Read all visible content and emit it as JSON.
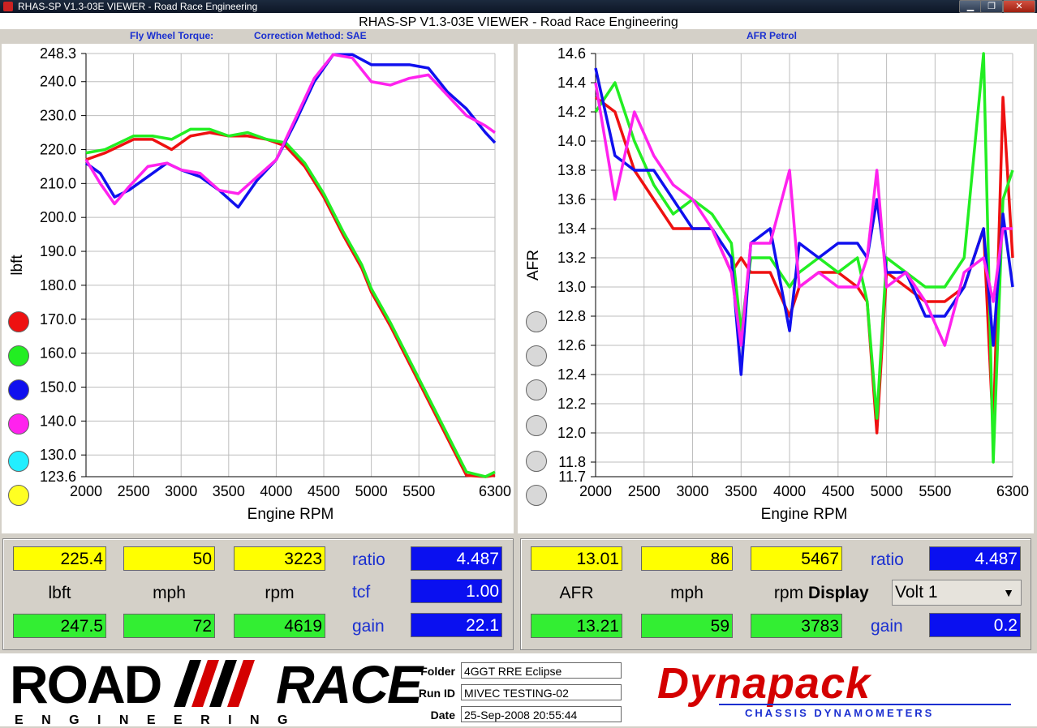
{
  "window": {
    "title": "RHAS-SP V1.3-03E VIEWER - Road Race Engineering"
  },
  "app": {
    "title": "RHAS-SP V1.3-03E VIEWER - Road Race Engineering"
  },
  "left_chart": {
    "header1": "Fly Wheel Torque:",
    "header2": "Correction Method: SAE",
    "ylabel": "lbft",
    "xlabel": "Engine RPM",
    "ymin_label": "123.6",
    "ymax_label": "248.3",
    "yticks": [
      "240.0",
      "230.0",
      "220.0",
      "210.0",
      "200.0",
      "190.0",
      "180.0",
      "170.0",
      "160.0",
      "150.0",
      "140.0",
      "130.0"
    ],
    "xticks": [
      "2000",
      "2500",
      "3000",
      "3500",
      "4000",
      "4500",
      "5000",
      "5500",
      "6300"
    ]
  },
  "right_chart": {
    "header": "AFR Petrol",
    "ylabel": "AFR",
    "xlabel": "Engine RPM",
    "yticks": [
      "14.6",
      "14.4",
      "14.2",
      "14.0",
      "13.8",
      "13.6",
      "13.4",
      "13.2",
      "13.0",
      "12.8",
      "12.6",
      "12.4",
      "12.2",
      "12.0",
      "11.8",
      "11.7"
    ],
    "xticks": [
      "2000",
      "2500",
      "3000",
      "3500",
      "4000",
      "4500",
      "5000",
      "5500",
      "6300"
    ]
  },
  "colors": {
    "red": "#ee1111",
    "green": "#22ee22",
    "blue": "#1010ee",
    "magenta": "#ff22ee",
    "cyan": "#22eeff",
    "yellow": "#ffff22"
  },
  "chart_data": [
    {
      "type": "line",
      "xlabel": "Engine RPM",
      "ylabel": "lbft",
      "xlim": [
        2000,
        6300
      ],
      "ylim": [
        123.6,
        248.3
      ],
      "series": [
        {
          "color": "red",
          "x": [
            2000,
            2200,
            2500,
            2700,
            2900,
            3100,
            3300,
            3500,
            3700,
            3900,
            4100,
            4300,
            4500,
            4700,
            4900,
            5000,
            5200,
            5400,
            5600,
            5800,
            6000,
            6200,
            6300
          ],
          "y": [
            217,
            219,
            223,
            223,
            220,
            224,
            225,
            224,
            224,
            223,
            221,
            215,
            206,
            195,
            185,
            178,
            168,
            157,
            146,
            135,
            124,
            108,
            124
          ]
        },
        {
          "color": "green",
          "x": [
            2000,
            2200,
            2500,
            2700,
            2900,
            3100,
            3300,
            3500,
            3700,
            3900,
            4100,
            4300,
            4500,
            4700,
            4900,
            5000,
            5200,
            5400,
            5600,
            5800,
            6000,
            6200,
            6300
          ],
          "y": [
            219,
            220,
            224,
            224,
            223,
            226,
            226,
            224,
            225,
            223,
            222,
            216,
            207,
            196,
            186,
            179,
            169,
            158,
            147,
            136,
            125,
            109,
            125
          ]
        },
        {
          "color": "blue",
          "x": [
            2000,
            2150,
            2300,
            2450,
            2650,
            2850,
            3000,
            3200,
            3400,
            3600,
            3800,
            4000,
            4200,
            4400,
            4600,
            4800,
            5000,
            5200,
            5400,
            5600,
            5800,
            6000,
            6200,
            6300
          ],
          "y": [
            216,
            213,
            206,
            208,
            212,
            216,
            214,
            212,
            208,
            203,
            211,
            217,
            228,
            240,
            248,
            248,
            245,
            245,
            245,
            244,
            237,
            232,
            225,
            222
          ]
        },
        {
          "color": "magenta",
          "x": [
            2000,
            2150,
            2300,
            2450,
            2650,
            2850,
            3000,
            3200,
            3400,
            3600,
            3800,
            4000,
            4200,
            4400,
            4600,
            4800,
            5000,
            5200,
            5400,
            5600,
            5800,
            6000,
            6200,
            6300
          ],
          "y": [
            217,
            210,
            204,
            209,
            215,
            216,
            214,
            213,
            208,
            207,
            212,
            217,
            229,
            241,
            248,
            247,
            240,
            239,
            241,
            242,
            236,
            230,
            227,
            225
          ]
        }
      ]
    },
    {
      "type": "line",
      "xlabel": "Engine RPM",
      "ylabel": "AFR",
      "xlim": [
        2000,
        6300
      ],
      "ylim": [
        11.7,
        14.6
      ],
      "series": [
        {
          "color": "red",
          "x": [
            2000,
            2200,
            2400,
            2600,
            2800,
            3000,
            3200,
            3400,
            3500,
            3600,
            3800,
            4000,
            4100,
            4300,
            4500,
            4700,
            4800,
            4900,
            5000,
            5200,
            5400,
            5600,
            5800,
            6000,
            6100,
            6200,
            6300
          ],
          "y": [
            14.3,
            14.2,
            13.8,
            13.6,
            13.4,
            13.4,
            13.4,
            13.1,
            13.2,
            13.1,
            13.1,
            12.8,
            13.0,
            13.1,
            13.1,
            13.0,
            12.9,
            12.0,
            13.1,
            13.0,
            12.9,
            12.9,
            13.0,
            13.4,
            12.0,
            14.3,
            13.2
          ]
        },
        {
          "color": "green",
          "x": [
            2000,
            2200,
            2400,
            2600,
            2800,
            3000,
            3200,
            3400,
            3500,
            3600,
            3800,
            4000,
            4100,
            4300,
            4500,
            4700,
            4800,
            4900,
            5000,
            5200,
            5400,
            5600,
            5800,
            6000,
            6100,
            6200,
            6300
          ],
          "y": [
            14.2,
            14.4,
            14.0,
            13.7,
            13.5,
            13.6,
            13.5,
            13.3,
            12.7,
            13.2,
            13.2,
            13.0,
            13.1,
            13.2,
            13.1,
            13.2,
            12.9,
            12.1,
            13.2,
            13.1,
            13.0,
            13.0,
            13.2,
            14.6,
            11.8,
            13.6,
            13.8
          ]
        },
        {
          "color": "blue",
          "x": [
            2000,
            2200,
            2400,
            2600,
            2800,
            3000,
            3200,
            3400,
            3500,
            3600,
            3800,
            4000,
            4100,
            4300,
            4500,
            4700,
            4800,
            4900,
            5000,
            5200,
            5400,
            5600,
            5800,
            6000,
            6100,
            6200,
            6300
          ],
          "y": [
            14.5,
            13.9,
            13.8,
            13.8,
            13.6,
            13.4,
            13.4,
            13.2,
            12.4,
            13.3,
            13.4,
            12.7,
            13.3,
            13.2,
            13.3,
            13.3,
            13.2,
            13.6,
            13.1,
            13.1,
            12.8,
            12.8,
            13.0,
            13.4,
            12.6,
            13.5,
            13.0
          ]
        },
        {
          "color": "magenta",
          "x": [
            2000,
            2200,
            2400,
            2600,
            2800,
            3000,
            3200,
            3400,
            3500,
            3600,
            3800,
            4000,
            4100,
            4300,
            4500,
            4700,
            4800,
            4900,
            5000,
            5200,
            5400,
            5600,
            5800,
            6000,
            6100,
            6200,
            6300
          ],
          "y": [
            14.4,
            13.6,
            14.2,
            13.9,
            13.7,
            13.6,
            13.4,
            13.1,
            12.6,
            13.3,
            13.3,
            13.8,
            13.0,
            13.1,
            13.0,
            13.0,
            13.2,
            13.8,
            13.0,
            13.1,
            12.9,
            12.6,
            13.1,
            13.2,
            12.9,
            13.4,
            13.4
          ]
        }
      ]
    }
  ],
  "left_panel": {
    "row1": [
      "225.4",
      "50",
      "3223"
    ],
    "units": [
      "lbft",
      "mph",
      "rpm"
    ],
    "row2": [
      "247.5",
      "72",
      "4619"
    ],
    "labels": [
      "ratio",
      "tcf",
      "gain"
    ],
    "values": [
      "4.487",
      "1.00",
      "22.1"
    ]
  },
  "right_panel": {
    "row1": [
      "13.01",
      "86",
      "5467"
    ],
    "units": [
      "AFR",
      "mph",
      "rpm"
    ],
    "display_label": "Display",
    "row2": [
      "13.21",
      "59",
      "3783"
    ],
    "ratio_label": "ratio",
    "ratio_value": "4.487",
    "gain_label": "gain",
    "gain_value": "0.2",
    "select_value": "Volt 1"
  },
  "footer": {
    "logo_left_top": "ROAD",
    "logo_left_right": "RACE",
    "logo_left_sub": "E N G I N E E R I N G",
    "folder_label": "Folder",
    "folder_value": "4GGT RRE Eclipse",
    "runid_label": "Run ID",
    "runid_value": "MIVEC TESTING-02",
    "date_label": "Date",
    "date_value": "25-Sep-2008  20:55:44",
    "logo_right": "Dynapack",
    "logo_right_sub": "CHASSIS  DYNAMOMETERS"
  }
}
